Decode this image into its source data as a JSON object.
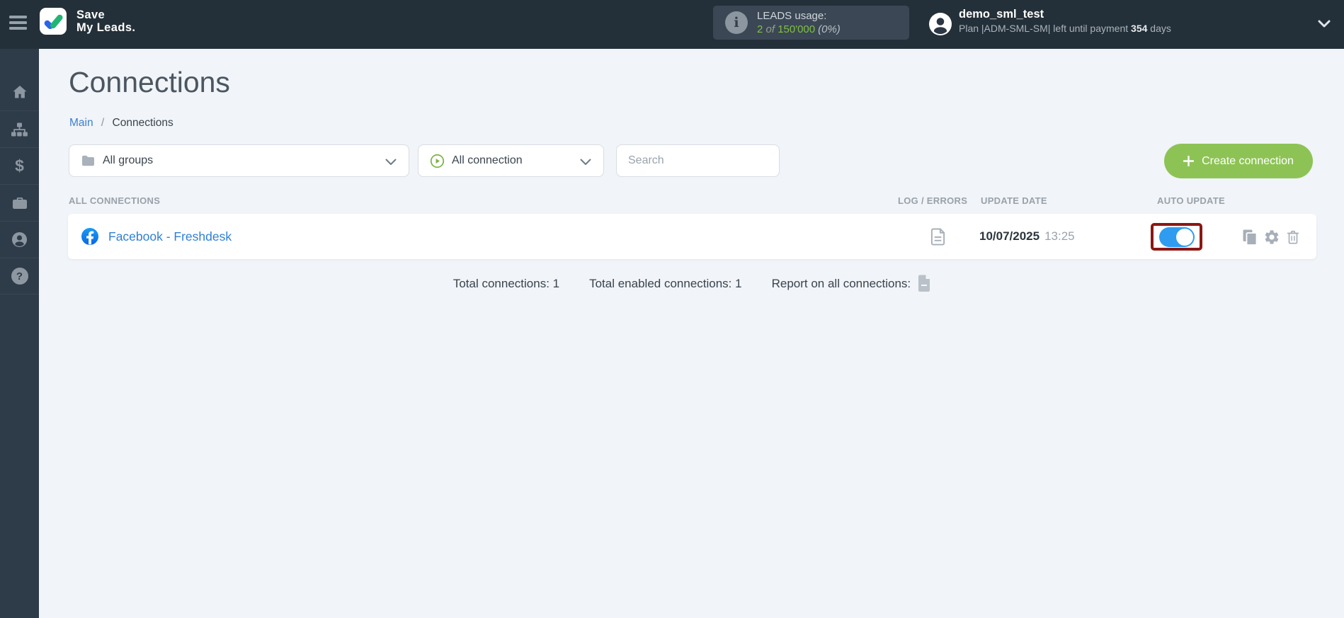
{
  "header": {
    "brand": {
      "line1": "Save",
      "line2": "My Leads."
    },
    "leads_usage": {
      "info_glyph": "i",
      "label": "LEADS usage:",
      "used": "2",
      "of_word": "of",
      "total": "150'000",
      "percent": "(0%)"
    },
    "user": {
      "name": "demo_sml_test",
      "plan_text": "Plan |ADM-SML-SM| left until payment",
      "days": "354",
      "days_suffix": "days"
    }
  },
  "sidebar": {
    "items": [
      "home",
      "connections-tree",
      "billing",
      "services",
      "account",
      "help"
    ],
    "billing_glyph": "$",
    "help_glyph": "?"
  },
  "page": {
    "title": "Connections",
    "breadcrumb": {
      "root": "Main",
      "separator": "/",
      "current": "Connections"
    }
  },
  "filters": {
    "groups_value": "All groups",
    "connection_value": "All connection",
    "search_placeholder": "Search",
    "create_button": "Create connection"
  },
  "connections": {
    "section_label": "ALL CONNECTIONS",
    "columns": {
      "log": "LOG / ERRORS",
      "update_date": "UPDATE DATE",
      "auto_update": "AUTO UPDATE"
    },
    "rows": [
      {
        "name": "Facebook - Freshdesk",
        "service_icon": "facebook-icon",
        "update_date": "10/07/2025",
        "update_time": "13:25",
        "auto_update_enabled": true
      }
    ]
  },
  "summary": {
    "total": "Total connections: 1",
    "enabled": "Total enabled connections: 1",
    "report_label": "Report on all connections:"
  },
  "colors": {
    "header_bg": "#243039",
    "sidebar_bg": "#2e3b48",
    "page_bg": "#f1f4f8",
    "accent_green": "#8dc355",
    "leads_green": "#7fc142",
    "toggle_blue": "#2f9cf0",
    "annotation_red": "#8b1713",
    "link_blue": "#2f80d5",
    "facebook_blue": "#1877f2"
  }
}
